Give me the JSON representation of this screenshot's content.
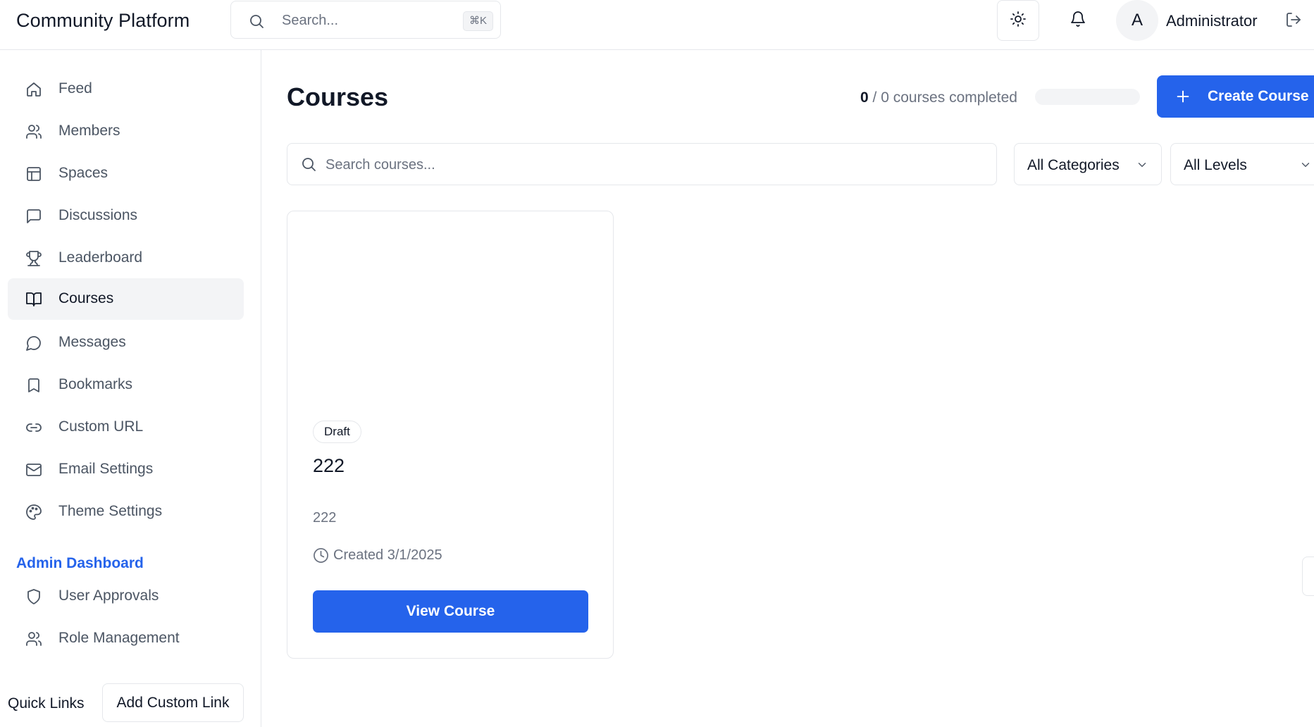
{
  "app": {
    "title": "Community Platform"
  },
  "header": {
    "search_placeholder": "Search...",
    "search_shortcut": "⌘K",
    "theme_icon": "sun-icon",
    "notifications_icon": "bell-icon",
    "avatar_initial": "A",
    "user_name": "Administrator",
    "logout_icon": "logout-icon"
  },
  "sidebar": {
    "items": [
      {
        "label": "Feed",
        "icon": "home-icon"
      },
      {
        "label": "Members",
        "icon": "users-icon"
      },
      {
        "label": "Spaces",
        "icon": "layout-icon"
      },
      {
        "label": "Discussions",
        "icon": "message-square-icon"
      },
      {
        "label": "Leaderboard",
        "icon": "trophy-icon"
      },
      {
        "label": "Courses",
        "icon": "book-open-icon",
        "active": true
      },
      {
        "label": "Messages",
        "icon": "message-circle-icon"
      },
      {
        "label": "Bookmarks",
        "icon": "bookmark-icon"
      },
      {
        "label": "Custom URL",
        "icon": "link-icon"
      },
      {
        "label": "Email Settings",
        "icon": "mail-icon"
      },
      {
        "label": "Theme Settings",
        "icon": "palette-icon"
      }
    ],
    "admin_heading": "Admin Dashboard",
    "admin_items": [
      {
        "label": "User Approvals",
        "icon": "shield-icon"
      },
      {
        "label": "Role Management",
        "icon": "users-icon"
      }
    ],
    "quick_links_label": "Quick Links",
    "add_custom_link_label": "Add Custom Link"
  },
  "main": {
    "title": "Courses",
    "progress": {
      "completed": "0",
      "suffix": " / 0 courses completed",
      "fraction": 0
    },
    "create_button": "Create Course",
    "search_placeholder": "Search courses...",
    "category_filter": "All Categories",
    "level_filter": "All Levels",
    "courses": [
      {
        "status": "Draft",
        "title": "222",
        "description": "222",
        "created": "Created 3/1/2025",
        "button": "View Course"
      }
    ]
  },
  "colors": {
    "accent": "#2563eb",
    "border": "#e5e7eb",
    "muted": "#6b7280",
    "active_bg": "#f3f4f6"
  }
}
